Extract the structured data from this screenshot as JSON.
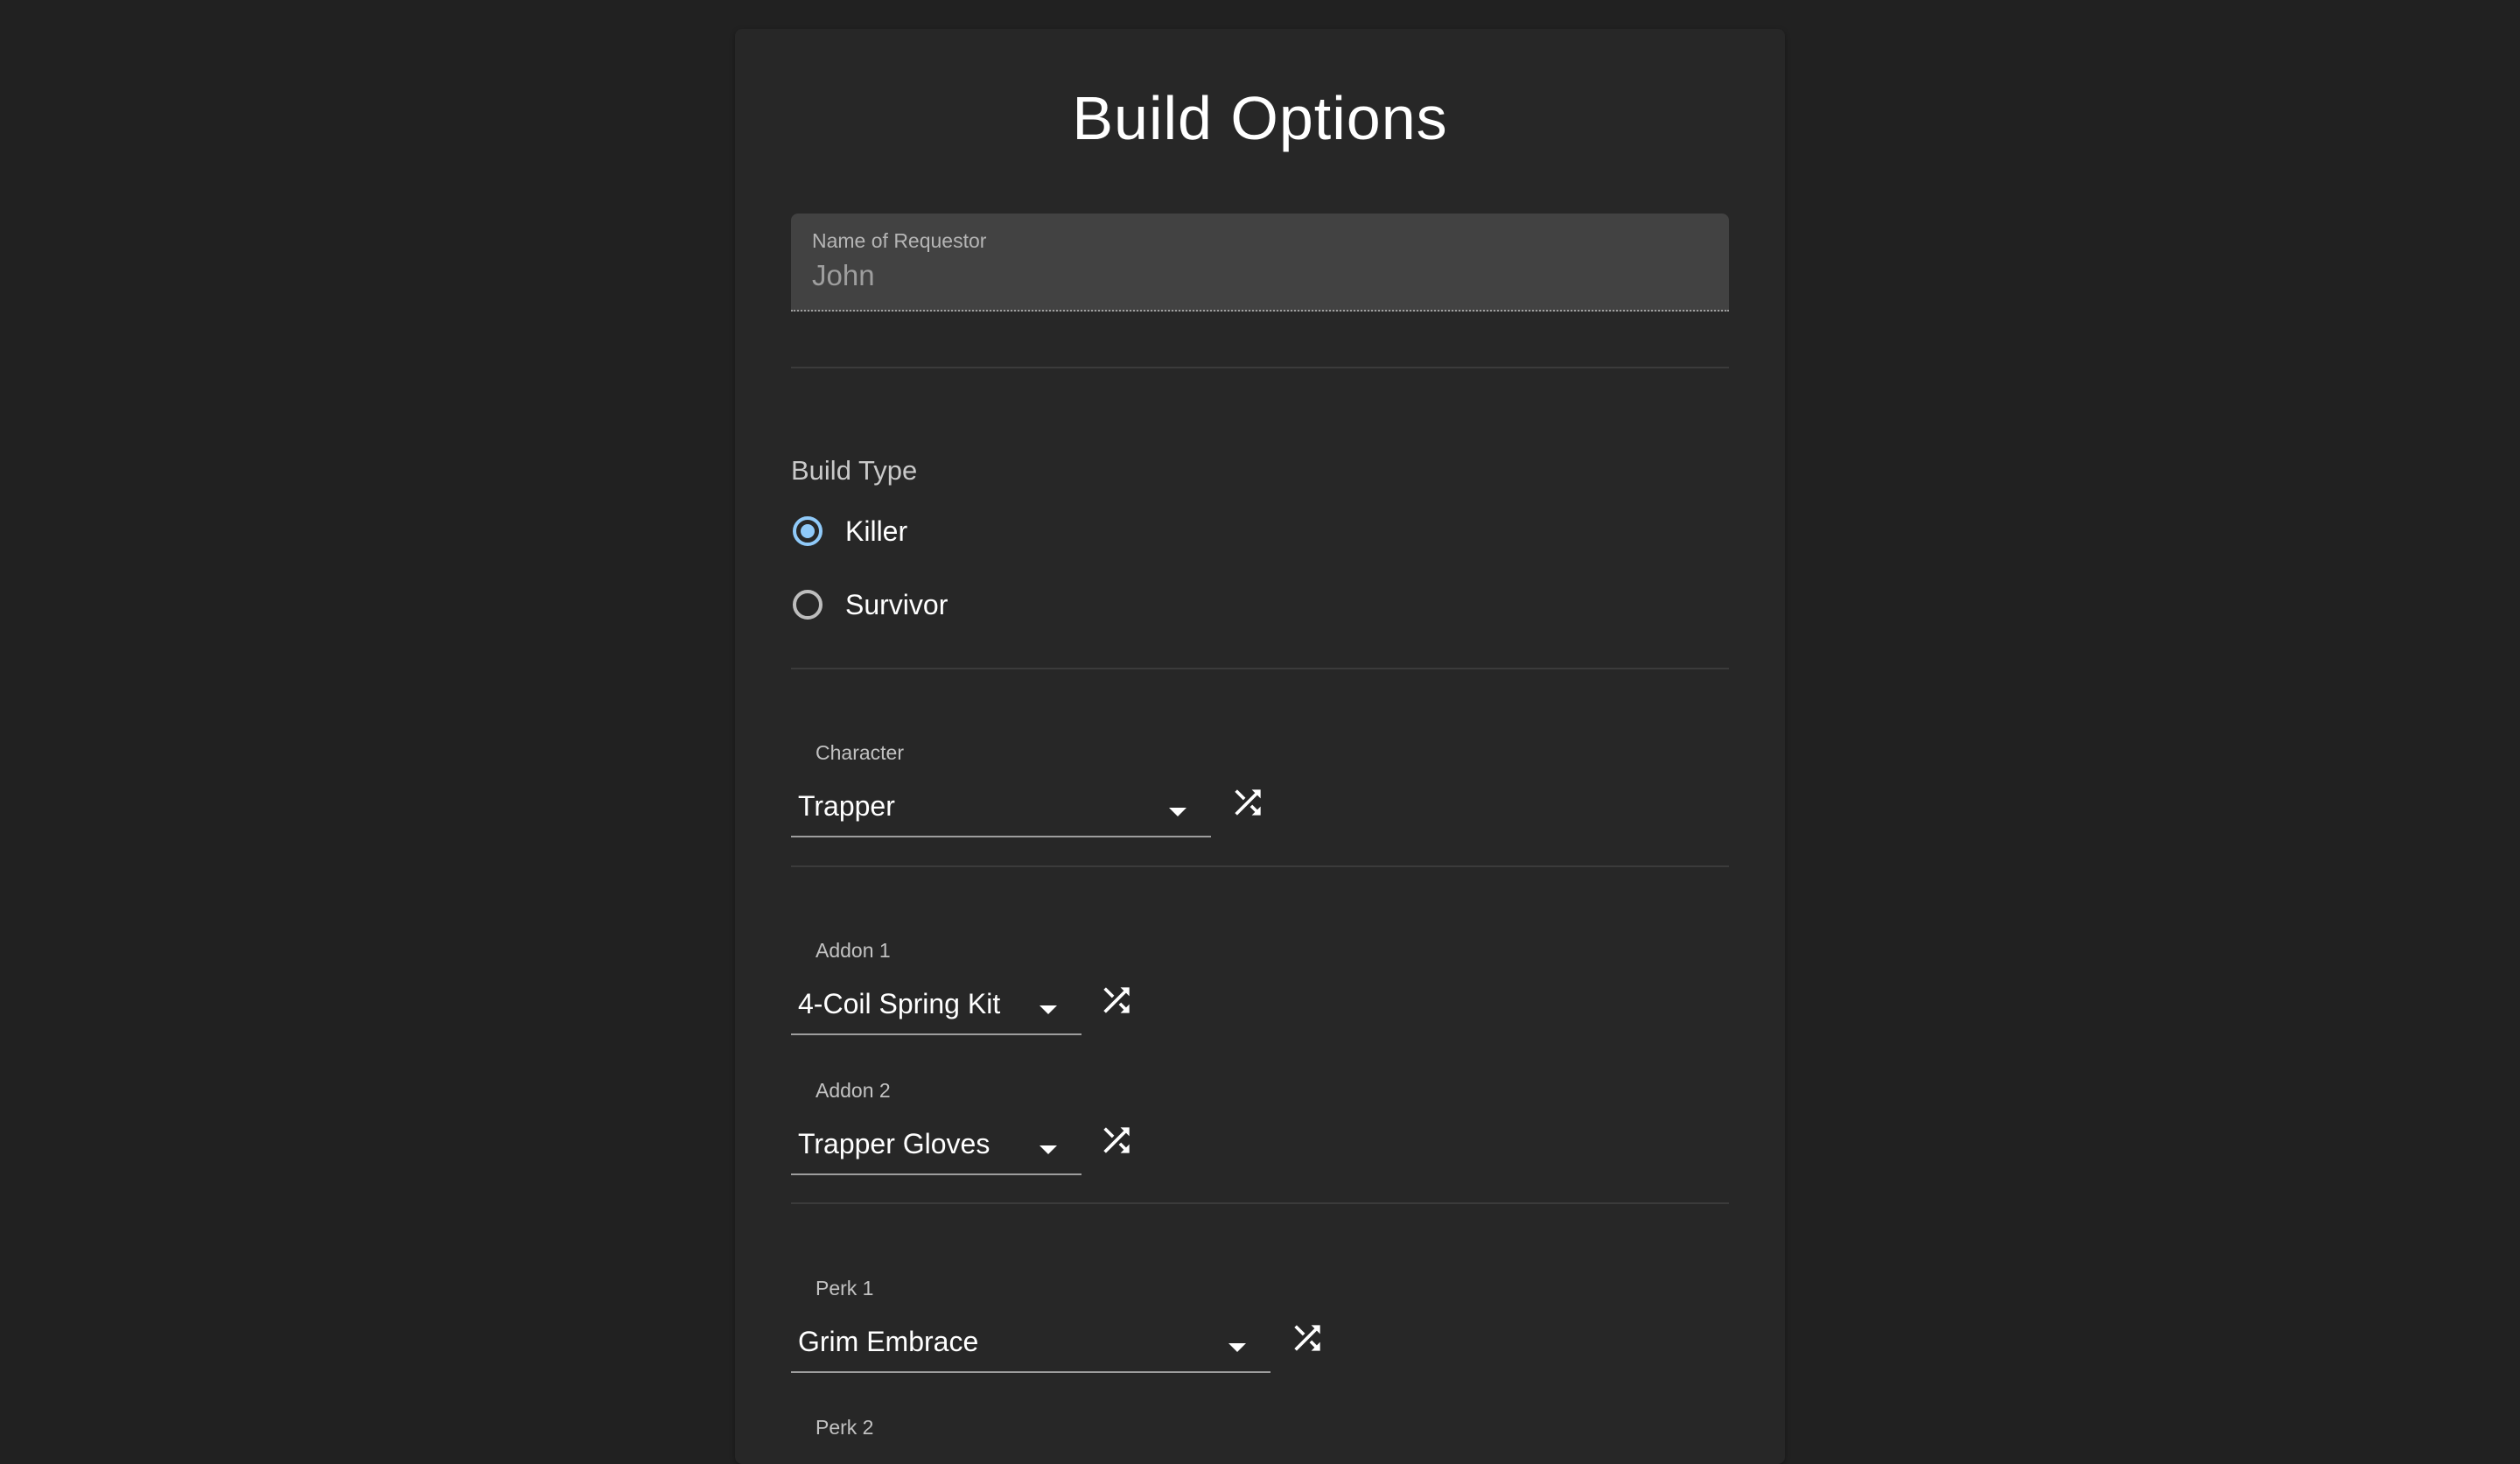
{
  "title": "Build Options",
  "requestor": {
    "label": "Name of Requestor",
    "value": "John"
  },
  "build_type": {
    "label": "Build Type",
    "options": [
      {
        "label": "Killer",
        "checked": true
      },
      {
        "label": "Survivor",
        "checked": false
      }
    ]
  },
  "character": {
    "label": "Character",
    "value": "Trapper"
  },
  "addons": [
    {
      "label": "Addon 1",
      "value": "4-Coil Spring Kit"
    },
    {
      "label": "Addon 2",
      "value": "Trapper Gloves"
    }
  ],
  "perks": [
    {
      "label": "Perk 1",
      "value": "Grim Embrace"
    },
    {
      "label": "Perk 2",
      "value": ""
    }
  ],
  "icons": {
    "shuffle": "shuffle-icon",
    "dropdown": "arrow-drop-down-icon"
  },
  "colors": {
    "background": "#212121",
    "card": "#272727",
    "field": "#424242",
    "accent": "#90caf9"
  }
}
